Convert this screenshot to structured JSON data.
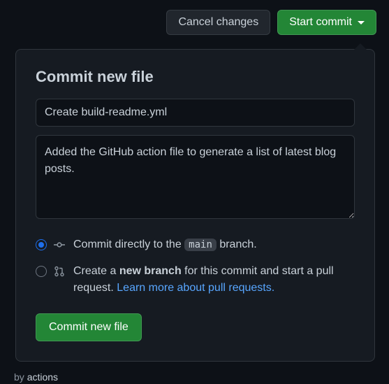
{
  "toolbar": {
    "cancel_label": "Cancel changes",
    "start_commit_label": "Start commit"
  },
  "popover": {
    "title": "Commit new file",
    "commit_message": "Create build-readme.yml",
    "description": "Added the GitHub action file to generate a list of latest blog posts.",
    "options": {
      "direct": {
        "prefix": "Commit directly to the ",
        "branch": "main",
        "suffix": " branch."
      },
      "new_branch": {
        "prefix": "Create a ",
        "bold": "new branch",
        "middle": " for this commit and start a pull request. ",
        "link_text": "Learn more about pull requests."
      }
    },
    "submit_label": "Commit new file"
  },
  "background": {
    "by_text": "by",
    "actor": "actions"
  }
}
